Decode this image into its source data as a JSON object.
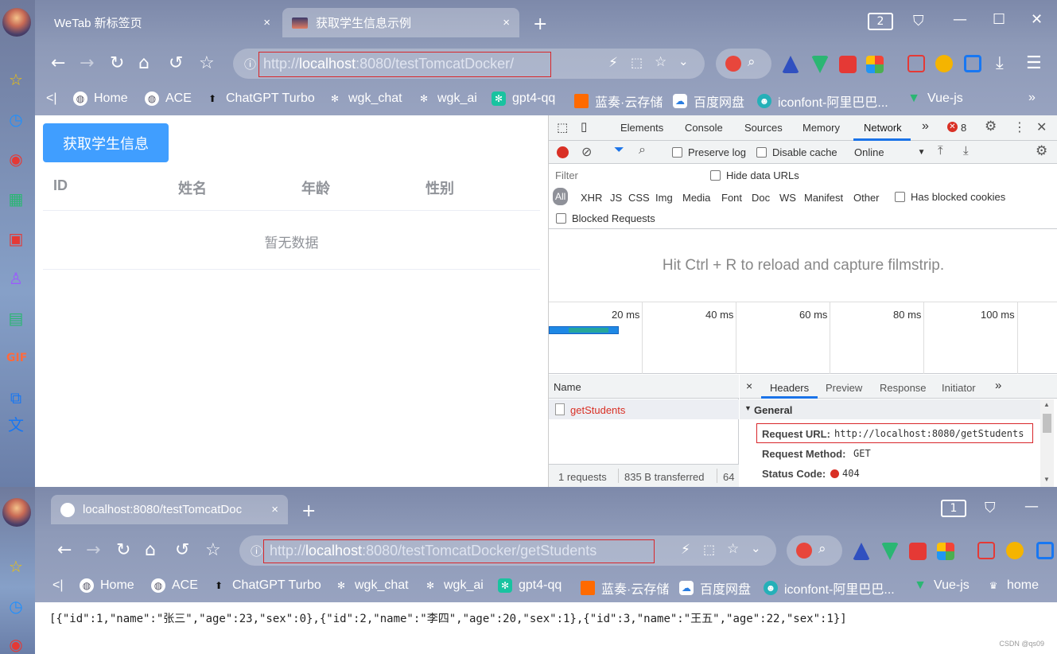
{
  "window1": {
    "tabs": [
      {
        "label": "WeTab 新标签页",
        "close": "×"
      },
      {
        "label": "获取学生信息示例",
        "close": "×"
      }
    ],
    "new_tab": "+",
    "window_count": "2",
    "url": {
      "prefix": "http://",
      "host": "localhost",
      "rest": ":8080/testTomcatDocker/"
    }
  },
  "window2": {
    "tabs": [
      {
        "label": "localhost:8080/testTomcatDoc",
        "close": "×"
      }
    ],
    "new_tab": "+",
    "window_count": "1",
    "url": {
      "prefix": "http://",
      "host": "localhost",
      "rest": ":8080/testTomcatDocker/getStudents"
    }
  },
  "bookmarks": {
    "collapse": "<|",
    "items": [
      "Home",
      "ACE",
      "ChatGPT Turbo",
      "wgk_chat",
      "wgk_ai",
      "gpt4-qq",
      "蓝奏·云存储",
      "百度网盘",
      "iconfont-阿里巴巴...",
      "Vue-js"
    ],
    "more": "»",
    "extra_item": "home"
  },
  "page1": {
    "fetch_button": "获取学生信息",
    "table": {
      "headers": [
        "ID",
        "姓名",
        "年龄",
        "性别"
      ],
      "empty_text": "暂无数据"
    }
  },
  "devtools": {
    "tabs": [
      "Elements",
      "Console",
      "Sources",
      "Memory",
      "Network"
    ],
    "active_tab": "Network",
    "more_tabs": "»",
    "error_count": "8",
    "preserve_log": "Preserve log",
    "disable_cache": "Disable cache",
    "throttle": "Online",
    "filter_placeholder": "Filter",
    "hide_data_urls": "Hide data URLs",
    "filter_types": [
      "All",
      "XHR",
      "JS",
      "CSS",
      "Img",
      "Media",
      "Font",
      "Doc",
      "WS",
      "Manifest",
      "Other"
    ],
    "has_blocked_cookies": "Has blocked cookies",
    "blocked_requests": "Blocked Requests",
    "filmstrip_hint": "Hit Ctrl + R to reload and capture filmstrip.",
    "timeline_ticks": [
      "20 ms",
      "40 ms",
      "60 ms",
      "80 ms",
      "100 ms"
    ],
    "name_header": "Name",
    "requests": [
      {
        "name": "getStudents"
      }
    ],
    "status_bar": {
      "requests": "1 requests",
      "transferred": "835 B transferred",
      "extra": "64"
    },
    "detail_tabs": [
      "Headers",
      "Preview",
      "Response",
      "Initiator"
    ],
    "detail_close": "×",
    "detail_more": "»",
    "general_section": "General",
    "general": {
      "request_url_label": "Request URL:",
      "request_url": "http://localhost:8080/getStudents",
      "method_label": "Request Method:",
      "method": "GET",
      "status_label": "Status Code:",
      "status": "404"
    }
  },
  "page2": {
    "json_body": "[{\"id\":1,\"name\":\"张三\",\"age\":23,\"sex\":0},{\"id\":2,\"name\":\"李四\",\"age\":20,\"sex\":1},{\"id\":3,\"name\":\"王五\",\"age\":22,\"sex\":1}]",
    "watermark": "CSDN @qs09"
  },
  "colors": {
    "primary": "#409eff",
    "highlight": "#d8262a",
    "network_tab": "#1a73e8",
    "error": "#d93025"
  }
}
